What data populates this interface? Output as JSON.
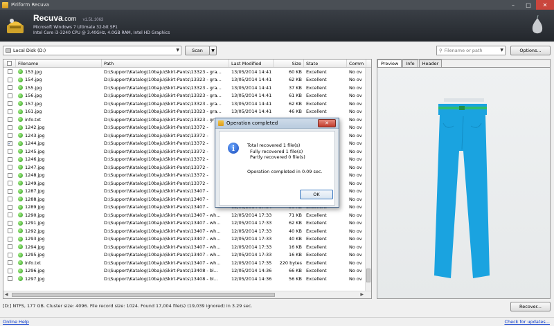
{
  "window": {
    "title": "Piriform Recuva"
  },
  "header": {
    "brand": "Recuva",
    "brand_suffix": ".com",
    "version": "v1.51.1063",
    "os_line": "Microsoft Windows 7 Ultimate 32-bit SP1",
    "hw_line": "Intel Core i3-3240 CPU @ 3.40GHz, 4.0GB RAM, Intel HD Graphics"
  },
  "toolbar": {
    "drive": "Local Disk (D:)",
    "scan_label": "Scan",
    "filter_placeholder": "Filename or path",
    "options_label": "Options..."
  },
  "columns": [
    "Filename",
    "Path",
    "Last Modified",
    "Size",
    "State",
    "Comm"
  ],
  "files": [
    {
      "name": "153.jpg",
      "path": "D:\\Support\\Katalog\\10baju\\Skirt-Pants\\13323 - gra...",
      "modified": "13/05/2014 14:41",
      "size": "60 KB",
      "state": "Excellent",
      "comment": "No ov",
      "checked": false
    },
    {
      "name": "154.jpg",
      "path": "D:\\Support\\Katalog\\10baju\\Skirt-Pants\\13323 - gra...",
      "modified": "13/05/2014 14:41",
      "size": "62 KB",
      "state": "Excellent",
      "comment": "No ov",
      "checked": false
    },
    {
      "name": "155.jpg",
      "path": "D:\\Support\\Katalog\\10baju\\Skirt-Pants\\13323 - gra...",
      "modified": "13/05/2014 14:41",
      "size": "37 KB",
      "state": "Excellent",
      "comment": "No ov",
      "checked": false
    },
    {
      "name": "156.jpg",
      "path": "D:\\Support\\Katalog\\10baju\\Skirt-Pants\\13323 - gra...",
      "modified": "13/05/2014 14:41",
      "size": "61 KB",
      "state": "Excellent",
      "comment": "No ov",
      "checked": false
    },
    {
      "name": "157.jpg",
      "path": "D:\\Support\\Katalog\\10baju\\Skirt-Pants\\13323 - gra...",
      "modified": "13/05/2014 14:41",
      "size": "62 KB",
      "state": "Excellent",
      "comment": "No ov",
      "checked": false
    },
    {
      "name": "161.jpg",
      "path": "D:\\Support\\Katalog\\10baju\\Skirt-Pants\\13323 - gra...",
      "modified": "13/05/2014 14:41",
      "size": "46 KB",
      "state": "Excellent",
      "comment": "No ov",
      "checked": false
    },
    {
      "name": "info.txt",
      "path": "D:\\Support\\Katalog\\10baju\\Skirt-Pants\\13323 - gra...",
      "modified": "",
      "size": "",
      "state": "",
      "comment": "No ov",
      "checked": false
    },
    {
      "name": "1242.jpg",
      "path": "D:\\Support\\Katalog\\10baju\\Skirt-Pants\\13372 -",
      "modified": "",
      "size": "",
      "state": "",
      "comment": "No ov",
      "checked": false
    },
    {
      "name": "1243.jpg",
      "path": "D:\\Support\\Katalog\\10baju\\Skirt-Pants\\13372 -",
      "modified": "",
      "size": "",
      "state": "",
      "comment": "No ov",
      "checked": false
    },
    {
      "name": "1244.jpg",
      "path": "D:\\Support\\Katalog\\10baju\\Skirt-Pants\\13372 -",
      "modified": "",
      "size": "",
      "state": "",
      "comment": "No ov",
      "checked": true
    },
    {
      "name": "1245.jpg",
      "path": "D:\\Support\\Katalog\\10baju\\Skirt-Pants\\13372 -",
      "modified": "",
      "size": "",
      "state": "",
      "comment": "No ov",
      "checked": false
    },
    {
      "name": "1246.jpg",
      "path": "D:\\Support\\Katalog\\10baju\\Skirt-Pants\\13372 -",
      "modified": "",
      "size": "",
      "state": "",
      "comment": "No ov",
      "checked": false
    },
    {
      "name": "1247.jpg",
      "path": "D:\\Support\\Katalog\\10baju\\Skirt-Pants\\13372 -",
      "modified": "",
      "size": "",
      "state": "",
      "comment": "No ov",
      "checked": false
    },
    {
      "name": "1248.jpg",
      "path": "D:\\Support\\Katalog\\10baju\\Skirt-Pants\\13372 -",
      "modified": "",
      "size": "",
      "state": "",
      "comment": "No ov",
      "checked": false
    },
    {
      "name": "1249.jpg",
      "path": "D:\\Support\\Katalog\\10baju\\Skirt-Pants\\13372 -",
      "modified": "",
      "size": "",
      "state": "",
      "comment": "No ov",
      "checked": false
    },
    {
      "name": "1287.jpg",
      "path": "D:\\Support\\Katalog\\10baju\\Skirt-Pants\\13407 -",
      "modified": "",
      "size": "",
      "state": "",
      "comment": "No ov",
      "checked": false
    },
    {
      "name": "1288.jpg",
      "path": "D:\\Support\\Katalog\\10baju\\Skirt-Pants\\13407 -",
      "modified": "",
      "size": "",
      "state": "",
      "comment": "No ov",
      "checked": false
    },
    {
      "name": "1289.jpg",
      "path": "D:\\Support\\Katalog\\10baju\\Skirt-Pants\\13407 -",
      "modified": "12/05/2014 17:34",
      "size": "56 KB",
      "state": "Excellent",
      "comment": "No ov",
      "checked": false
    },
    {
      "name": "1290.jpg",
      "path": "D:\\Support\\Katalog\\10baju\\Skirt-Pants\\13407 - wh...",
      "modified": "12/05/2014 17:33",
      "size": "71 KB",
      "state": "Excellent",
      "comment": "No ov",
      "checked": false
    },
    {
      "name": "1291.jpg",
      "path": "D:\\Support\\Katalog\\10baju\\Skirt-Pants\\13407 - wh...",
      "modified": "12/05/2014 17:33",
      "size": "62 KB",
      "state": "Excellent",
      "comment": "No ov",
      "checked": false
    },
    {
      "name": "1292.jpg",
      "path": "D:\\Support\\Katalog\\10baju\\Skirt-Pants\\13407 - wh...",
      "modified": "12/05/2014 17:33",
      "size": "40 KB",
      "state": "Excellent",
      "comment": "No ov",
      "checked": false
    },
    {
      "name": "1293.jpg",
      "path": "D:\\Support\\Katalog\\10baju\\Skirt-Pants\\13407 - wh...",
      "modified": "12/05/2014 17:33",
      "size": "40 KB",
      "state": "Excellent",
      "comment": "No ov",
      "checked": false
    },
    {
      "name": "1294.jpg",
      "path": "D:\\Support\\Katalog\\10baju\\Skirt-Pants\\13407 - wh...",
      "modified": "12/05/2014 17:33",
      "size": "16 KB",
      "state": "Excellent",
      "comment": "No ov",
      "checked": false
    },
    {
      "name": "1295.jpg",
      "path": "D:\\Support\\Katalog\\10baju\\Skirt-Pants\\13407 - wh...",
      "modified": "12/05/2014 17:33",
      "size": "16 KB",
      "state": "Excellent",
      "comment": "No ov",
      "checked": false
    },
    {
      "name": "info.txt",
      "path": "D:\\Support\\Katalog\\10baju\\Skirt-Pants\\13407 - wh...",
      "modified": "12/05/2014 17:35",
      "size": "220 bytes",
      "state": "Excellent",
      "comment": "No ov",
      "checked": false
    },
    {
      "name": "1296.jpg",
      "path": "D:\\Support\\Katalog\\10baju\\Skirt-Pants\\13408 - bl...",
      "modified": "12/05/2014 14:36",
      "size": "66 KB",
      "state": "Excellent",
      "comment": "No ov",
      "checked": false
    },
    {
      "name": "1297.jpg",
      "path": "D:\\Support\\Katalog\\10baju\\Skirt-Pants\\13408 - bl...",
      "modified": "12/05/2014 14:36",
      "size": "56 KB",
      "state": "Excellent",
      "comment": "No ov",
      "checked": false
    }
  ],
  "preview_tabs": [
    "Preview",
    "Info",
    "Header"
  ],
  "status": "[D:] NTFS, 177 GB. Cluster size: 4096. File record size: 1024. Found 17,004 file(s) (19,039 ignored) in 3.29 sec.",
  "recover_label": "Recover...",
  "footer": {
    "help": "Online Help",
    "updates": "Check for updates..."
  },
  "dialog": {
    "title": "Operation completed",
    "total": "Total recovered 1 file(s)",
    "fully": "Fully recovered  1 file(s)",
    "partly": "Partly recovered 0 file(s)",
    "done": "Operation completed in 0.09 sec.",
    "ok_label": "OK"
  },
  "colors": {
    "pants": "#1aa3e0",
    "header_bg": "#2b2f35",
    "accent_green": "#2e9a1e"
  }
}
